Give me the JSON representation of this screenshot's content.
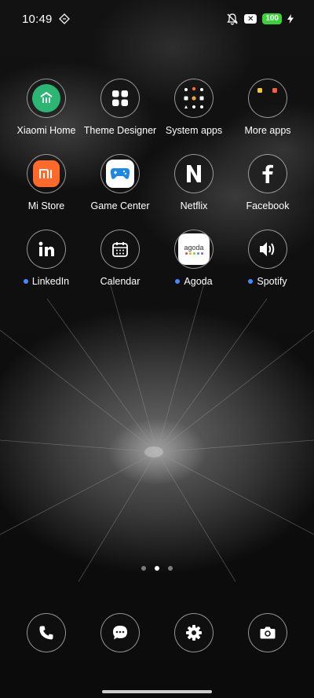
{
  "status_bar": {
    "time": "10:49",
    "battery": "100",
    "mute_icon": "bell-muted-icon",
    "notification_icon": "x-box-icon",
    "charging_icon": "lightning-icon"
  },
  "apps": [
    {
      "label": "Xiaomi Home",
      "icon": "xiaomi-home-icon",
      "dot": false
    },
    {
      "label": "Theme Designer",
      "icon": "theme-designer-icon",
      "dot": false
    },
    {
      "label": "System apps",
      "icon": "folder-icon",
      "dot": false
    },
    {
      "label": "More apps",
      "icon": "folder-icon",
      "dot": false
    },
    {
      "label": "Mi Store",
      "icon": "mi-store-icon",
      "dot": false
    },
    {
      "label": "Game Center",
      "icon": "gamepad-icon",
      "dot": false
    },
    {
      "label": "Netflix",
      "icon": "netflix-icon",
      "dot": false
    },
    {
      "label": "Facebook",
      "icon": "facebook-icon",
      "dot": false
    },
    {
      "label": "LinkedIn",
      "icon": "linkedin-icon",
      "dot": true
    },
    {
      "label": "Calendar",
      "icon": "calendar-icon",
      "dot": false
    },
    {
      "label": "Agoda",
      "icon": "agoda-icon",
      "dot": true,
      "icon_text": "agoda"
    },
    {
      "label": "Spotify",
      "icon": "spotify-icon",
      "dot": true
    }
  ],
  "page_indicator": {
    "count": 3,
    "active_index": 1
  },
  "dock": [
    {
      "icon": "phone-icon"
    },
    {
      "icon": "messages-icon"
    },
    {
      "icon": "settings-icon"
    },
    {
      "icon": "camera-icon"
    }
  ],
  "colors": {
    "new_app_dot": "#4a86ff",
    "battery": "#3ad33a",
    "xiaomi_home": "#2bb673",
    "mi_store": "#ff6a2b",
    "game_center": "#1e88e5"
  }
}
